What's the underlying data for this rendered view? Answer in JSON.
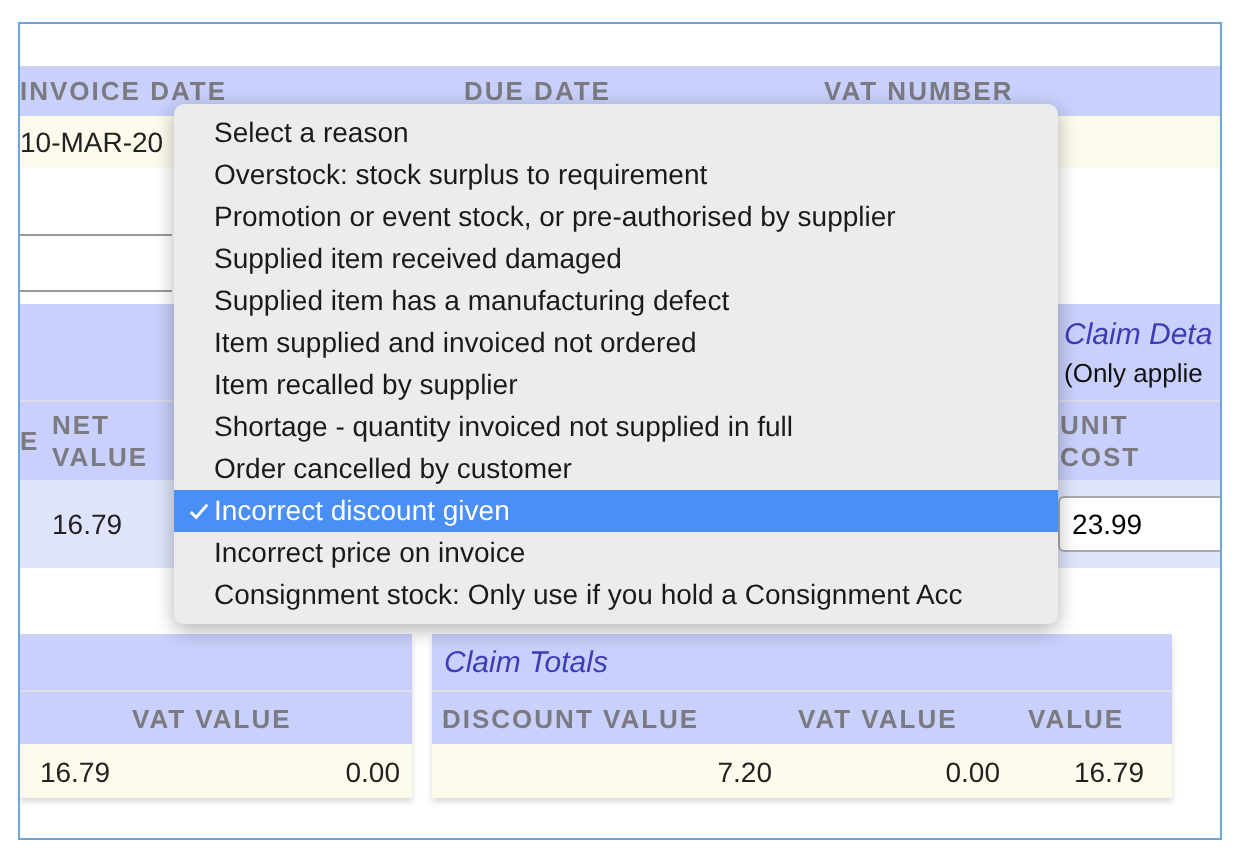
{
  "header": {
    "labels": [
      "INVOICE DATE",
      "DUE DATE",
      "VAT NUMBER"
    ],
    "invoice_date": "10-MAR-20"
  },
  "claim_details": {
    "title": "Claim Deta",
    "note": "(Only applie",
    "columns": [
      "E",
      "NET VALUE",
      "UNIT COST"
    ],
    "net_value": "16.79",
    "unit_cost": "23.99"
  },
  "totals_left": {
    "columns": [
      "VAT VALUE"
    ],
    "cells": [
      "16.79",
      "0.00"
    ]
  },
  "claim_totals": {
    "title": "Claim Totals",
    "columns": [
      "DISCOUNT VALUE",
      "VAT VALUE",
      "VALUE"
    ],
    "cells": [
      "7.20",
      "0.00",
      "16.79"
    ]
  },
  "reason_menu": {
    "options": [
      {
        "label": "Select a reason",
        "selected": false
      },
      {
        "label": "Overstock: stock surplus to requirement",
        "selected": false
      },
      {
        "label": "Promotion or event stock, or pre-authorised by supplier",
        "selected": false
      },
      {
        "label": "Supplied item received damaged",
        "selected": false
      },
      {
        "label": "Supplied item has a manufacturing defect",
        "selected": false
      },
      {
        "label": "Item supplied and invoiced not ordered",
        "selected": false
      },
      {
        "label": "Item recalled by supplier",
        "selected": false
      },
      {
        "label": "Shortage - quantity invoiced not supplied in full",
        "selected": false
      },
      {
        "label": "Order cancelled by customer",
        "selected": false
      },
      {
        "label": "Incorrect discount given",
        "selected": true
      },
      {
        "label": "Incorrect price on invoice",
        "selected": false
      },
      {
        "label": "Consignment stock: Only use if you hold a Consignment Acc",
        "selected": false
      }
    ]
  }
}
